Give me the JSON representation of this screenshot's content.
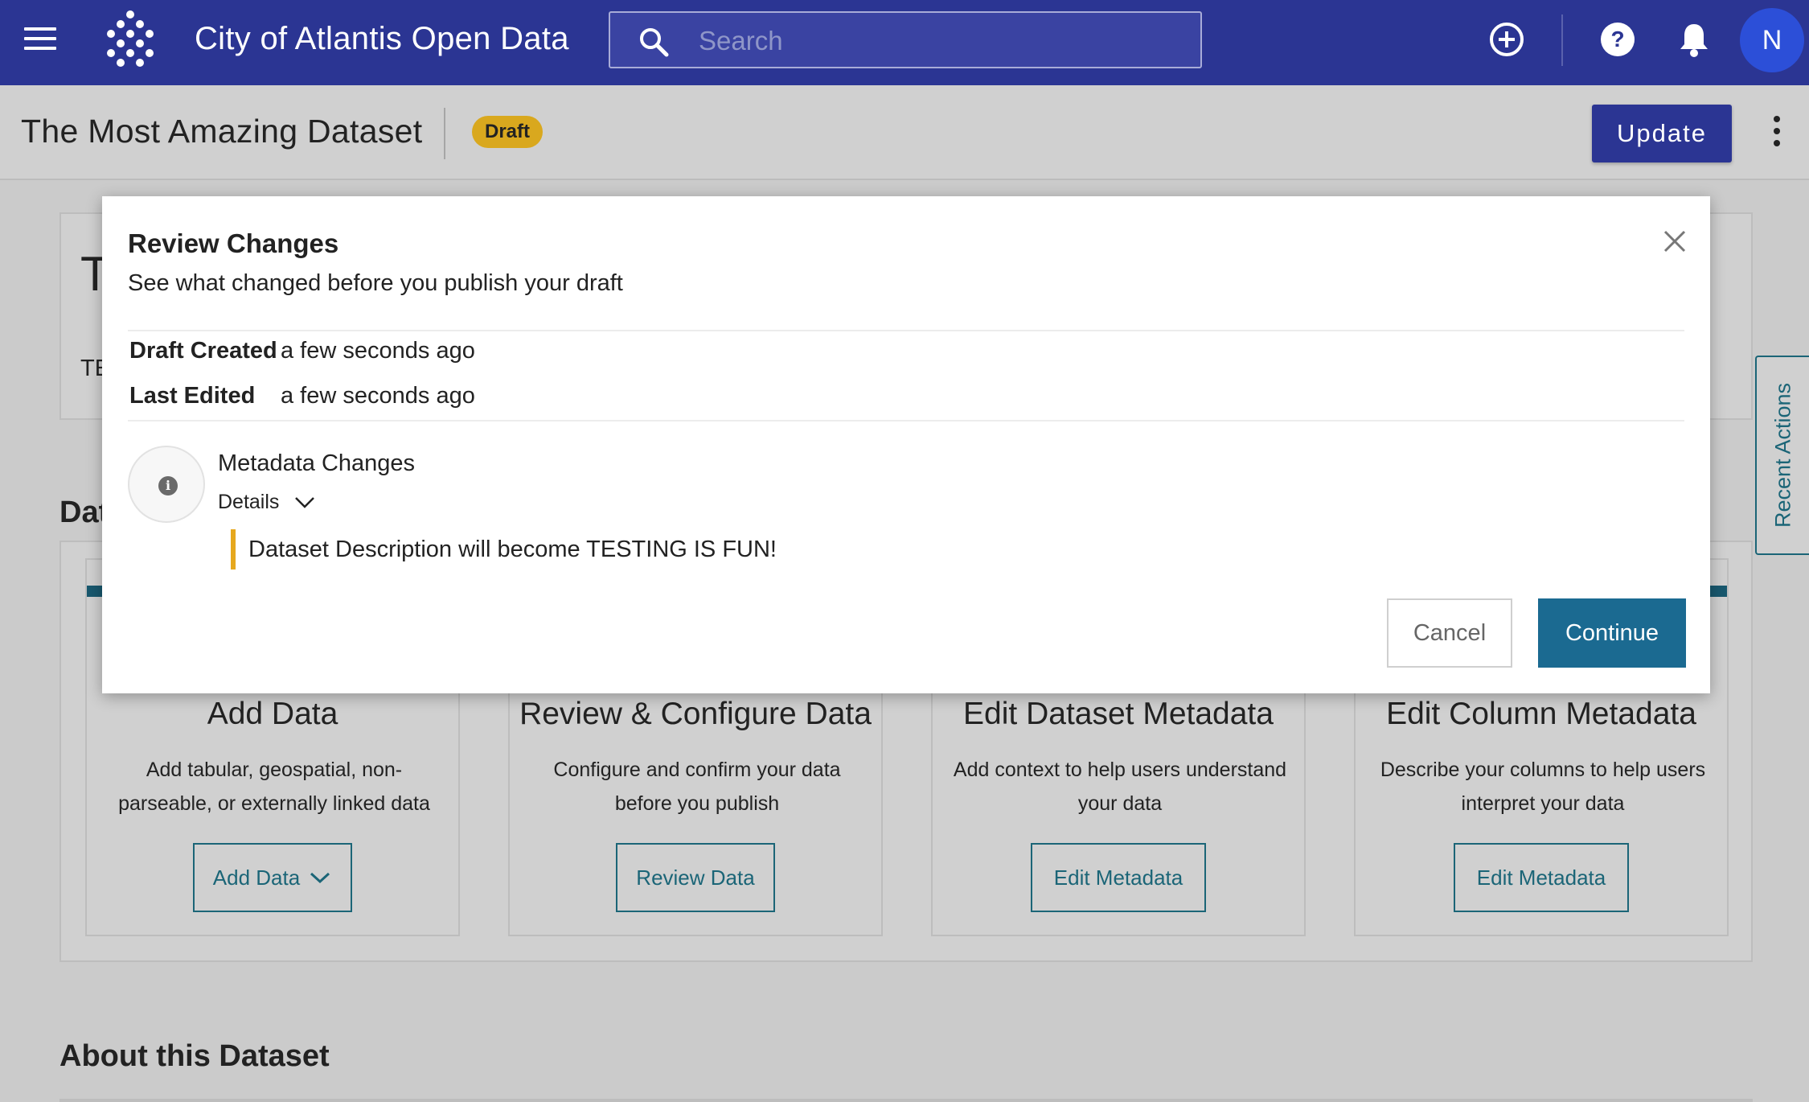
{
  "app": {
    "title": "City of Atlantis Open Data",
    "brand_color": "#2b3593"
  },
  "search": {
    "placeholder": "Search",
    "value": ""
  },
  "nav_icons": [
    "menu-icon",
    "logo-icon",
    "search-icon",
    "add-circle-icon",
    "help-icon",
    "bell-icon"
  ],
  "user": {
    "initial": "N"
  },
  "dataset": {
    "title": "The Most Amazing Dataset",
    "status_badge": "Draft",
    "update_label": "Update"
  },
  "background": {
    "title_fragment": "T",
    "desc_fragment": "TE",
    "section_fragment": "Dat",
    "about_heading": "About this Dataset",
    "recent_actions_label": "Recent Actions",
    "steps": [
      {
        "title": "Add Data",
        "description": "Add tabular, geospatial, non-parseable, or externally linked data",
        "button": "Add Data"
      },
      {
        "title": "Review & Configure Data",
        "description": "Configure and confirm your data before you publish",
        "button": "Review Data"
      },
      {
        "title": "Edit Dataset Metadata",
        "description": "Add context to help users understand your data",
        "button": "Edit Metadata"
      },
      {
        "title": "Edit Column Metadata",
        "description": "Describe your columns to help users interpret your data",
        "button": "Edit Metadata"
      }
    ]
  },
  "modal": {
    "title": "Review Changes",
    "subtitle": "See what changed before you publish your draft",
    "draft_created_label": "Draft Created",
    "draft_created_value": "a few seconds ago",
    "last_edited_label": "Last Edited",
    "last_edited_value": "a few seconds ago",
    "change_group_title": "Metadata Changes",
    "details_label": "Details",
    "changes": [
      "Dataset Description will become TESTING IS FUN!"
    ],
    "cancel_label": "Cancel",
    "continue_label": "Continue",
    "continue_color": "#1b6a91",
    "change_accent_color": "#e6a81e"
  }
}
